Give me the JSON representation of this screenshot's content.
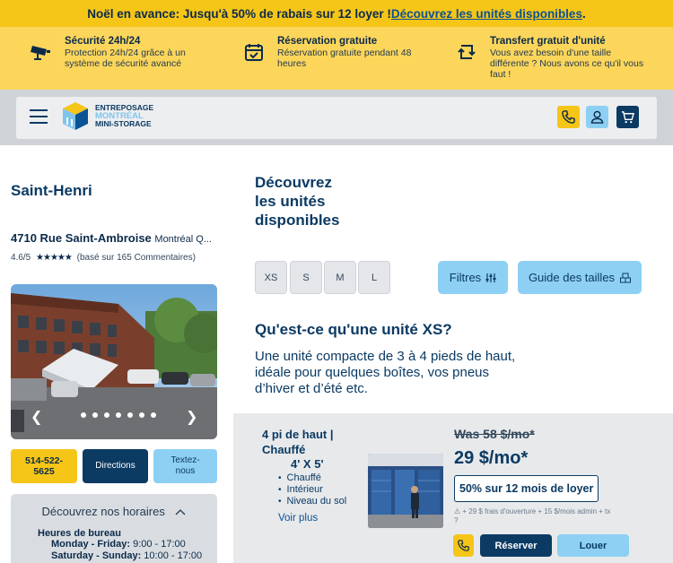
{
  "promo": {
    "text": "Noël en avance: Jusqu'à 50% de rabais sur 12 loyer ! ",
    "link": "Découvrez les unités disponibles",
    "end": "."
  },
  "features": [
    {
      "icon": "security-camera-icon",
      "title": "Sécurité 24h/24",
      "desc": "Protection 24h/24 grâce à un système de sécurité avancé"
    },
    {
      "icon": "calendar-check-icon",
      "title": "Réservation gratuite",
      "desc": "Réservation gratuite pendant 48 heures"
    },
    {
      "icon": "transfer-arrows-icon",
      "title": "Transfert gratuit d'unité",
      "desc": "Vous avez besoin d'une taille différente ? Nous avons ce qu'il vous faut !"
    }
  ],
  "header": {
    "logo": {
      "line1": "ENTREPOSAGE",
      "line2": "MONTRÉAL",
      "line3": "MINI-STORAGE"
    }
  },
  "location": {
    "name": "Saint-Henri",
    "street": "4710 Rue Saint-Ambroise",
    "city": "Montréal Q...",
    "rating": "4.6/5",
    "stars": "★★★★★",
    "reviews": "(basé sur 165 Commentaires)",
    "photo_dots": 7,
    "prev": "❮",
    "next": "❯",
    "phone": "514-522-5625",
    "directions": "Directions",
    "text_us": "Textez-nous"
  },
  "hours": {
    "toggle": "Découvrez nos horaires",
    "heading": "Heures de bureau",
    "rows": [
      {
        "days": "Monday - Friday:",
        "time": " 9:00 - 17:00"
      },
      {
        "days": "Saturday - Sunday:",
        "time": " 10:00 - 17:00"
      }
    ]
  },
  "units": {
    "title": "Découvrez\nles unités\ndisponibles",
    "sizes": [
      "XS",
      "S",
      "M",
      "L"
    ],
    "filters": "Filtres",
    "guide": "Guide des tailles",
    "question": "Qu'est-ce qu'une unité XS?",
    "description": "Une unité compacte de 3 à 4 pieds de haut, idéale pour quelques boîtes, vos pneus d’hiver et d’été etc."
  },
  "card": {
    "line1": "4 pi de haut |",
    "line2": "Chauffé",
    "dimensions": "4' X 5'",
    "features": [
      "Chauffé",
      "Intérieur",
      "Niveau du sol"
    ],
    "more": "Voir plus",
    "was": "Was 58 $/mo*",
    "price": "29 $/mo*",
    "deal": "50% sur 12 mois de loyer",
    "fees": "+ 29 $ frais d'ouverture + 15 $/mois admin + tx",
    "reserve": "Réserver",
    "rent": "Louer"
  },
  "colors": {
    "yellow": "#f5c518",
    "navy": "#0b3a63",
    "lightblue": "#8dd0f3"
  }
}
